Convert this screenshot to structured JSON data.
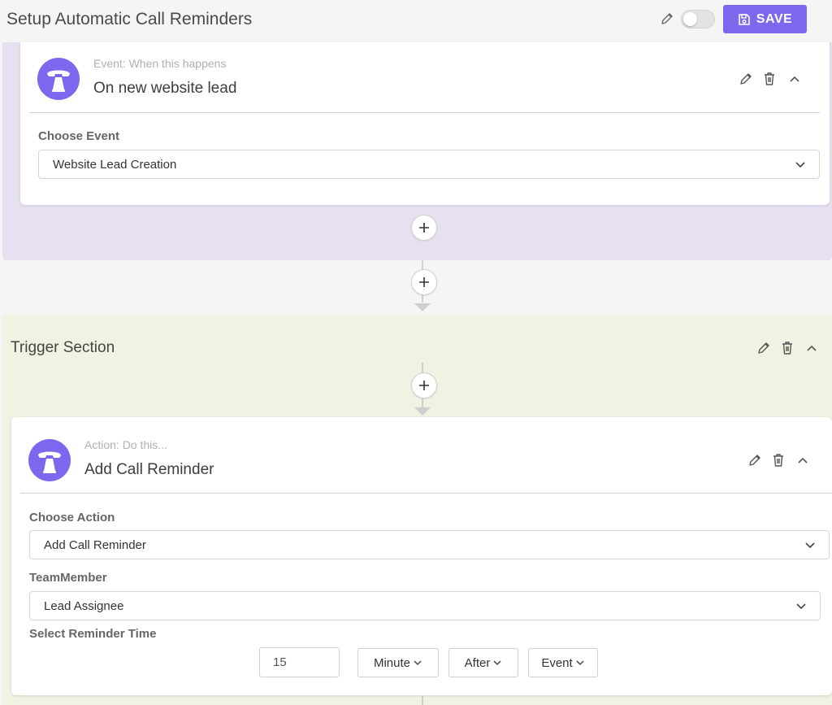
{
  "header": {
    "title": "Setup Automatic Call Reminders",
    "save_label": "SAVE",
    "toggle_on": false
  },
  "event": {
    "subtitle": "Event: When this happens",
    "title": "On new website lead",
    "field_label": "Choose Event",
    "field_value": "Website Lead Creation"
  },
  "trigger": {
    "title": "Trigger Section"
  },
  "action": {
    "subtitle": "Action: Do this...",
    "title": "Add Call Reminder",
    "choose_action_label": "Choose Action",
    "choose_action_value": "Add Call Reminder",
    "team_member_label": "TeamMember",
    "team_member_value": "Lead Assignee",
    "reminder_label": "Select Reminder Time",
    "reminder_amount": "15",
    "reminder_unit": "Minute",
    "reminder_relation": "After",
    "reminder_reference": "Event"
  },
  "colors": {
    "accent": "#7b68ee",
    "event_section_bg": "#e6e0f1",
    "trigger_section_bg": "#f2f2e3"
  },
  "icons": {
    "avatar": "telephone-icon",
    "edit": "pencil-icon",
    "delete": "trash-icon",
    "collapse": "chevron-up-icon",
    "add": "plus-icon",
    "save": "floppy-disk-icon"
  }
}
